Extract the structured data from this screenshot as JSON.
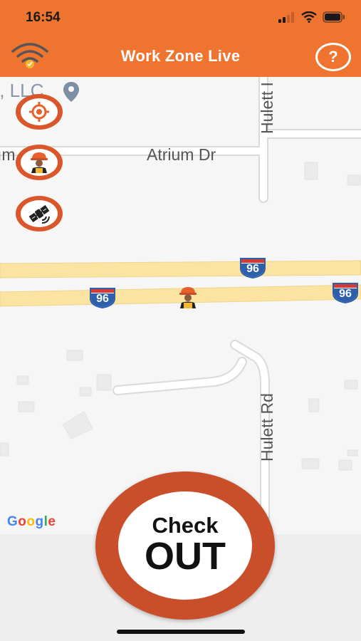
{
  "status_bar": {
    "time": "16:54"
  },
  "header": {
    "title": "Work Zone Live",
    "help_label": "?"
  },
  "map": {
    "partial_label": "., LLC",
    "street_atrium": "Atrium Dr",
    "street_hulett_top": "Hulett I",
    "street_hulett_bottom": "Hulett Rd",
    "left_fragment": "ım",
    "highway_shield_1": "96",
    "highway_shield_2": "96",
    "highway_shield_3": "96",
    "google_letters": [
      "G",
      "o",
      "o",
      "g",
      "l",
      "e"
    ]
  },
  "colors": {
    "brand_orange": "#ee7430",
    "button_rust": "#c94f2b",
    "highway": "#fbe4a1",
    "interstate_blue": "#2d5fab",
    "interstate_red": "#d23b36"
  },
  "check_button": {
    "line1": "Check",
    "line2": "OUT"
  },
  "fab_icons": [
    "locate-icon",
    "worker-icon",
    "satellite-icon"
  ]
}
